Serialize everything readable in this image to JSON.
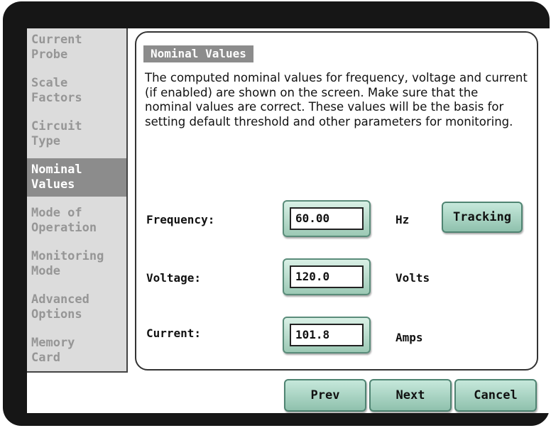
{
  "sidebar": {
    "items": [
      {
        "label": "Current\nProbe"
      },
      {
        "label": "Scale\nFactors"
      },
      {
        "label": "Circuit\nType"
      },
      {
        "label": "Nominal\nValues"
      },
      {
        "label": "Mode of\nOperation"
      },
      {
        "label": "Monitoring\nMode"
      },
      {
        "label": "Advanced\nOptions"
      },
      {
        "label": "Memory\nCard"
      }
    ],
    "active": "Nominal Values"
  },
  "main": {
    "title": "Nominal Values",
    "description": "The computed nominal values for frequency, voltage and current (if enabled) are shown on the screen. Make sure that the nominal values are correct. These values will be the basis for setting default threshold and other parameters for monitoring.",
    "fields": {
      "frequency": {
        "label": "Frequency:",
        "value": "60.00",
        "unit": "Hz"
      },
      "voltage": {
        "label": "Voltage:",
        "value": "120.0",
        "unit": "Volts"
      },
      "current": {
        "label": "Current:",
        "value": "101.8",
        "unit": "Amps"
      }
    },
    "tracking_label": "Tracking"
  },
  "footer": {
    "prev_label": "Prev",
    "next_label": "Next",
    "cancel_label": "Cancel"
  },
  "colors": {
    "bezel": "#161616",
    "sidebar_bg": "#dcdcdc",
    "sidebar_active_bg": "#8c8c8c",
    "sidebar_text": "#969696",
    "button_teal": "#9cc9b5"
  }
}
